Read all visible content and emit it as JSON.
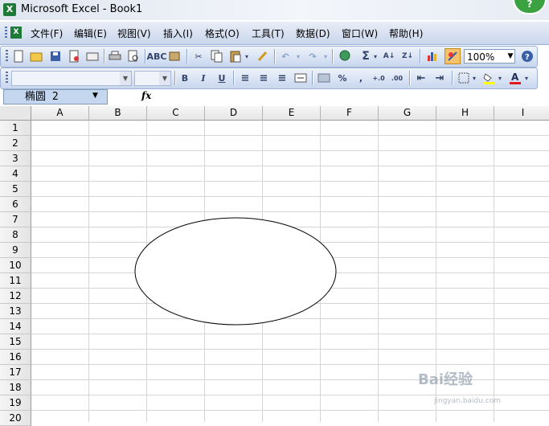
{
  "window": {
    "title": "Microsoft Excel - Book1"
  },
  "menu": [
    "文件(F)",
    "编辑(E)",
    "视图(V)",
    "插入(I)",
    "格式(O)",
    "工具(T)",
    "数据(D)",
    "窗口(W)",
    "帮助(H)"
  ],
  "toolbar": {
    "zoom": "100%"
  },
  "formula_bar": {
    "name_box": "椭圆 2",
    "fx_label": "fx"
  },
  "columns": [
    "A",
    "B",
    "C",
    "D",
    "E",
    "F",
    "G",
    "H",
    "I"
  ],
  "rows": [
    "1",
    "2",
    "3",
    "4",
    "5",
    "6",
    "7",
    "8",
    "9",
    "10",
    "11",
    "12",
    "13",
    "14",
    "15",
    "16",
    "17",
    "18",
    "19",
    "20"
  ],
  "shape": {
    "type": "oval"
  },
  "watermark": {
    "brand": "Bai经验",
    "url": "jingyan.baidu.com"
  }
}
